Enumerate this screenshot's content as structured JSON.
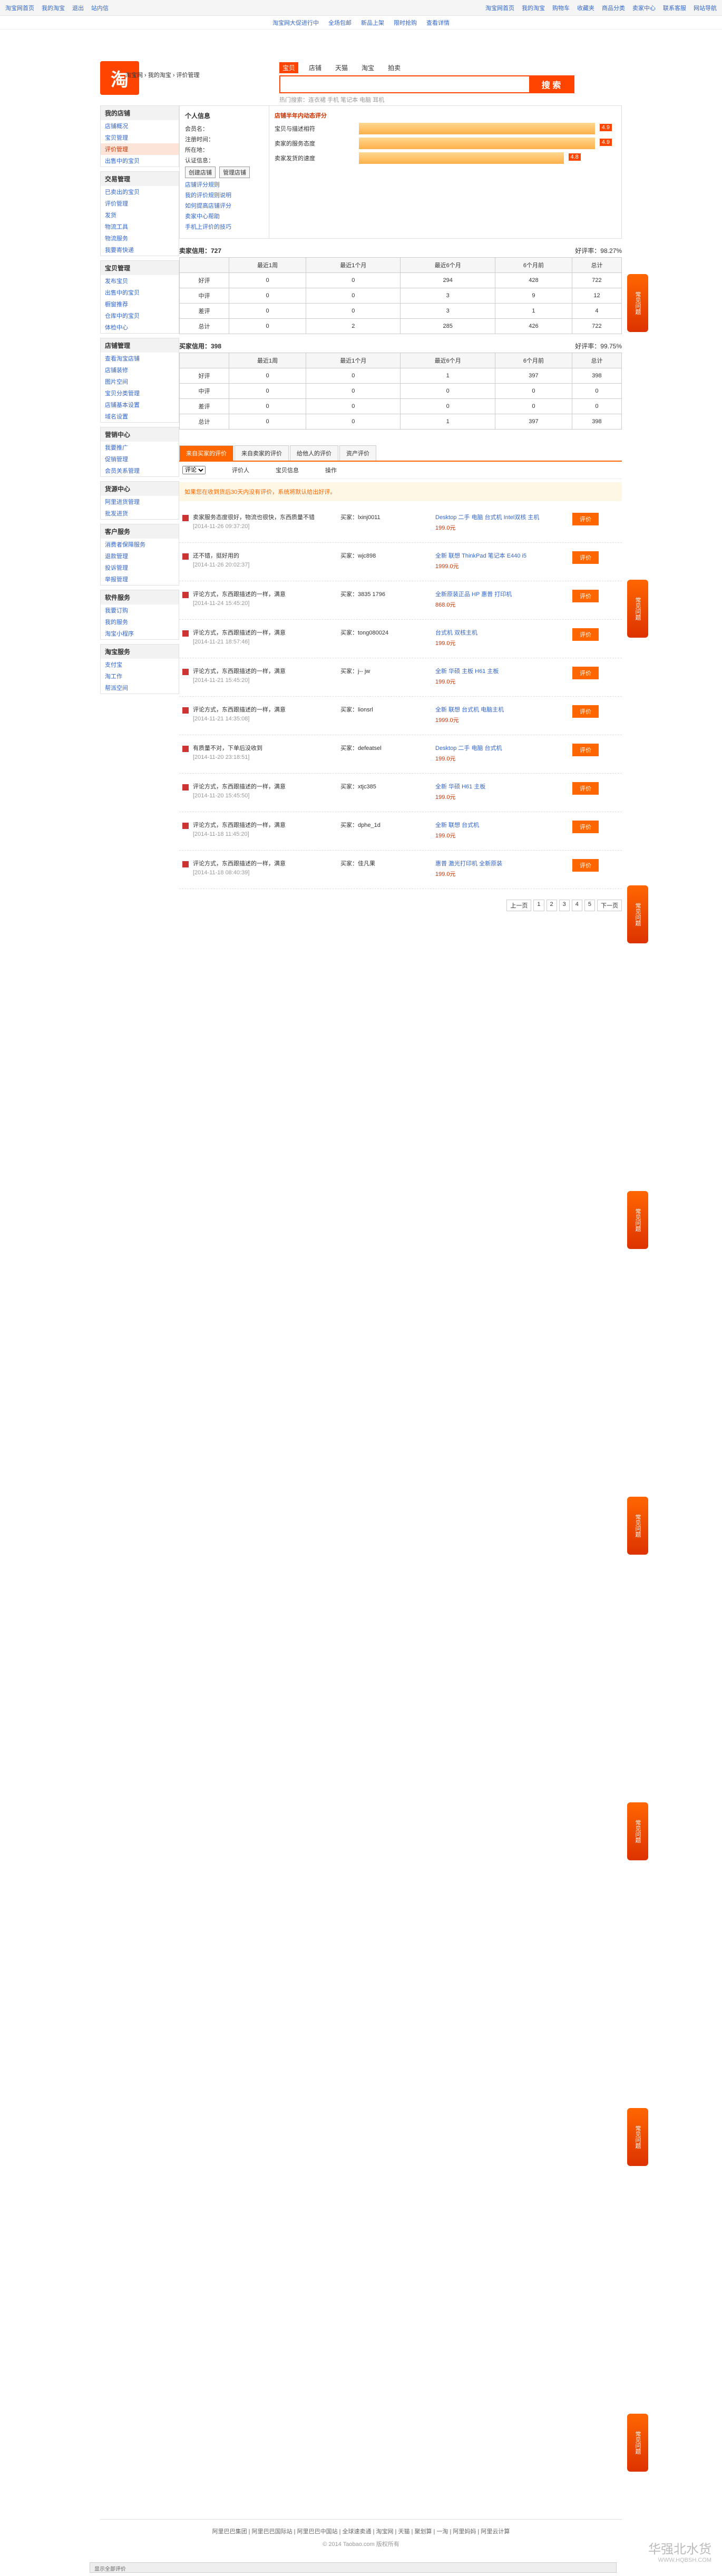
{
  "topbar": {
    "left": [
      "淘宝网首页",
      "我的淘宝",
      "退出",
      "站内信"
    ],
    "right": [
      "淘宝网首页",
      "我的淘宝",
      "购物车",
      "收藏夹",
      "商品分类",
      "卖家中心",
      "联系客服",
      "网站导航"
    ]
  },
  "notices": [
    "淘宝网大促进行中",
    "全场包邮",
    "新品上架",
    "限时抢购",
    "查看详情"
  ],
  "logo": "淘",
  "crumbs": "淘宝网 › 我的淘宝 › 评价管理",
  "search": {
    "tabs": [
      "宝贝",
      "店铺",
      "天猫",
      "淘宝",
      "拍卖"
    ],
    "placeholder": "",
    "button": "搜 索",
    "hot": "热门搜索：连衣裙 手机 笔记本 电脑 耳机"
  },
  "sidebar": [
    {
      "title": "我的店铺",
      "items": [
        "店铺概况",
        "宝贝管理",
        "评价管理",
        "出售中的宝贝"
      ]
    },
    {
      "title": "交易管理",
      "items": [
        "已卖出的宝贝",
        "评价管理",
        "发货",
        "物流工具",
        "物流服务",
        "我要寄快递"
      ]
    },
    {
      "title": "宝贝管理",
      "items": [
        "发布宝贝",
        "出售中的宝贝",
        "橱窗推荐",
        "仓库中的宝贝",
        "体检中心"
      ]
    },
    {
      "title": "店铺管理",
      "items": [
        "查看淘宝店铺",
        "店铺装修",
        "图片空间",
        "宝贝分类管理",
        "店铺基本设置",
        "域名设置"
      ]
    },
    {
      "title": "营销中心",
      "items": [
        "我要推广",
        "促销管理",
        "会员关系管理"
      ]
    },
    {
      "title": "货源中心",
      "items": [
        "阿里进货管理",
        "批发进货"
      ]
    },
    {
      "title": "客户服务",
      "items": [
        "消费者保障服务",
        "退款管理",
        "投诉管理",
        "举报管理"
      ]
    },
    {
      "title": "软件服务",
      "items": [
        "我要订购",
        "我的服务",
        "淘宝小程序"
      ]
    },
    {
      "title": "淘宝服务",
      "items": [
        "支付宝",
        "淘工作",
        "帮派空间"
      ]
    }
  ],
  "profile": {
    "title": "个人信息",
    "nick": "会员名：",
    "reg": "注册时间：",
    "loc": "所在地：",
    "auth": "认证信息：",
    "buttons": [
      "创建店铺",
      "管理店铺"
    ],
    "links": [
      "店铺评分规则",
      "我的评价规则说明",
      "如何提高店铺评分",
      "卖家中心帮助",
      "手机上评价的技巧"
    ]
  },
  "ratings": {
    "title": "店铺半年内动态评分",
    "rows": [
      {
        "label": "宝贝与描述相符",
        "score": "4.9",
        "pct": 0.7
      },
      {
        "label": "卖家的服务态度",
        "score": "4.9",
        "pct": 0.8
      },
      {
        "label": "卖家发货的速度",
        "score": "4.8",
        "pct": 0.6
      }
    ]
  },
  "seller_stat": {
    "title": "卖家信用：727",
    "rate": "好评率：98.27%",
    "head": [
      "",
      "最近1周",
      "最近1个月",
      "最近6个月",
      "6个月前",
      "总计"
    ],
    "rows": [
      [
        "好评",
        "0",
        "0",
        "294",
        "428",
        "722"
      ],
      [
        "中评",
        "0",
        "0",
        "3",
        "9",
        "12"
      ],
      [
        "差评",
        "0",
        "0",
        "3",
        "1",
        "4"
      ],
      [
        "总计",
        "0",
        "2",
        "285",
        "426",
        "722"
      ]
    ]
  },
  "buyer_stat": {
    "title": "买家信用：398",
    "rate": "好评率：99.75%",
    "head": [
      "",
      "最近1周",
      "最近1个月",
      "最近6个月",
      "6个月前",
      "总计"
    ],
    "rows": [
      [
        "好评",
        "0",
        "0",
        "1",
        "397",
        "398"
      ],
      [
        "中评",
        "0",
        "0",
        "0",
        "0",
        "0"
      ],
      [
        "差评",
        "0",
        "0",
        "0",
        "0",
        "0"
      ],
      [
        "总计",
        "0",
        "0",
        "1",
        "397",
        "398"
      ]
    ]
  },
  "review_tabs": [
    "来自买家的评价",
    "来自卖家的评价",
    "给他人的评价",
    "资产评价"
  ],
  "filters": {
    "label": "评论",
    "col_who": "评价人",
    "col_prod": "宝贝信息",
    "col_op": "操作"
  },
  "tip": "如果您在收到货后30天内没有评价，系统将默认给出好评。",
  "reviews": [
    {
      "text": "卖家服务态度很好，物流也很快，东西质量不错",
      "date": "[2014-11-26 09:37:20]",
      "who": "买家：lxinj0011",
      "prod": "Desktop 二手 电脑 台式机 Intel双核 主机",
      "price": "199.0元"
    },
    {
      "text": "还不错，挺好用的",
      "date": "[2014-11-26 20:02:37]",
      "who": "买家：wjc898",
      "prod": "全新 联想 ThinkPad 笔记本 E440 i5",
      "price": "1999.0元"
    },
    {
      "text": "评论方式，东西跟描述的一样，满意",
      "date": "[2014-11-24 15:45:20]",
      "who": "买家：3835 1796",
      "prod": "全新原装正品 HP 惠普 打印机",
      "price": "868.0元"
    },
    {
      "text": "评论方式，东西跟描述的一样，满意",
      "date": "[2014-11-21 18:57:46]",
      "who": "买家：tong080024",
      "prod": "台式机 双核主机",
      "price": "199.0元"
    },
    {
      "text": "评论方式，东西跟描述的一样，满意",
      "date": "[2014-11-21 15:45:20]",
      "who": "买家：j-- jw",
      "prod": "全新 华硕 主板 H61 主板",
      "price": "199.0元"
    },
    {
      "text": "评论方式，东西跟描述的一样，满意",
      "date": "[2014-11-21 14:35:08]",
      "who": "买家：lionsrl",
      "prod": "全新 联想 台式机 电脑主机",
      "price": "1999.0元"
    },
    {
      "text": "有质量不对，下单后没收到",
      "date": "[2014-11-20 23:18:51]",
      "who": "买家：defeatsel",
      "prod": "Desktop 二手 电脑 台式机",
      "price": "199.0元"
    },
    {
      "text": "评论方式，东西跟描述的一样，满意",
      "date": "[2014-11-20 15:45:50]",
      "who": "买家：xtjc385",
      "prod": "全新 华硕 H61 主板",
      "price": "199.0元"
    },
    {
      "text": "评论方式，东西跟描述的一样，满意",
      "date": "[2014-11-18 11:45:20]",
      "who": "买家：dphe_1d",
      "prod": "全新 联想 台式机",
      "price": "199.0元"
    },
    {
      "text": "评论方式，东西跟描述的一样，满意",
      "date": "[2014-11-18 08:40:39]",
      "who": "买家：佳凡果",
      "prod": "惠普 激光打印机 全新原装",
      "price": "199.0元"
    }
  ],
  "ops": "评价",
  "pager": [
    "上一页",
    "1",
    "2",
    "3",
    "4",
    "5",
    "下一页"
  ],
  "mascot": "常见问题",
  "footer": "阿里巴巴集团 | 阿里巴巴国际站 | 阿里巴巴中国站 | 全球速卖通 | 淘宝网 | 天猫 | 聚划算 | 一淘 | 阿里妈妈 | 阿里云计算",
  "copyright": "© 2014 Taobao.com 版权所有",
  "statusbar": "显示全部评价",
  "watermark": "华强北水货",
  "watermark_sub": "WWW.HQBSH.COM"
}
